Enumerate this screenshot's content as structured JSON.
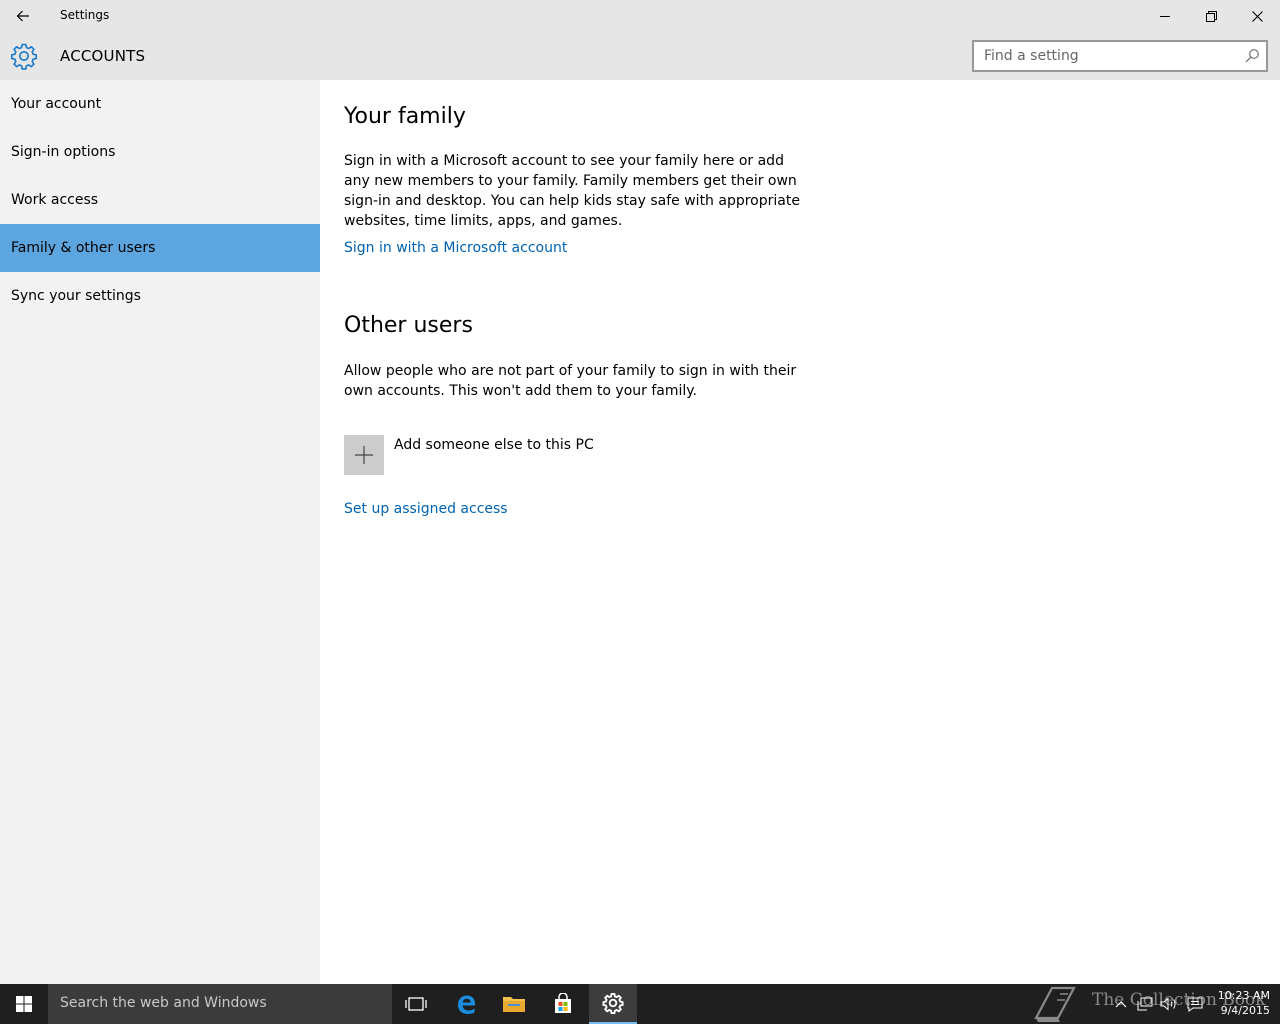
{
  "window": {
    "title": "Settings"
  },
  "header": {
    "section": "ACCOUNTS",
    "search_placeholder": "Find a setting"
  },
  "sidebar": {
    "items": [
      {
        "label": "Your account"
      },
      {
        "label": "Sign-in options"
      },
      {
        "label": "Work access"
      },
      {
        "label": "Family & other users",
        "selected": true
      },
      {
        "label": "Sync your settings"
      }
    ]
  },
  "main": {
    "family": {
      "title": "Your family",
      "description": "Sign in with a Microsoft account to see your family here or add any new members to your family. Family members get their own sign-in and desktop. You can help kids stay safe with appropriate websites, time limits, apps, and games.",
      "link": "Sign in with a Microsoft account"
    },
    "other_users": {
      "title": "Other users",
      "description": "Allow people who are not part of your family to sign in with their own accounts. This won't add them to your family.",
      "add_label": "Add someone else to this PC"
    },
    "assigned_access_link": "Set up assigned access"
  },
  "taskbar": {
    "search_text": "Search the web and Windows",
    "watermark": "The Collection Book",
    "time": "10:23 AM",
    "date": "9/4/2015"
  },
  "colors": {
    "accent": "#0063b1",
    "selected_nav": "#5da5de",
    "sidebar_bg": "#f2f2f2",
    "chrome_bg": "#e6e6e6",
    "taskbar_bg": "#1f1f1f"
  }
}
